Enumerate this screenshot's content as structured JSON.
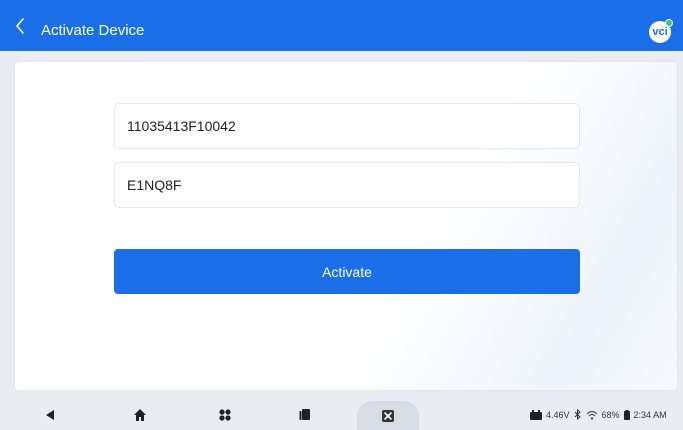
{
  "header": {
    "title": "Activate Device",
    "badge_label": "vci"
  },
  "form": {
    "serial_value": "11035413F10042",
    "code_value": "E1NQ8F",
    "activate_label": "Activate"
  },
  "status_bar": {
    "voltage": "4.46V",
    "battery": "68%",
    "time": "2:34 AM"
  },
  "icons": {
    "back": "chevron-left-icon",
    "nav_back": "triangle-back-icon",
    "home": "home-icon",
    "apps": "apps-icon",
    "recent": "recent-apps-icon",
    "tool": "diagnostic-tool-icon",
    "car_battery": "car-battery-icon",
    "bluetooth": "bluetooth-icon",
    "wifi": "wifi-icon",
    "battery": "battery-icon"
  },
  "colors": {
    "primary": "#1a6fe8",
    "vci_dot": "#3fc46a"
  }
}
